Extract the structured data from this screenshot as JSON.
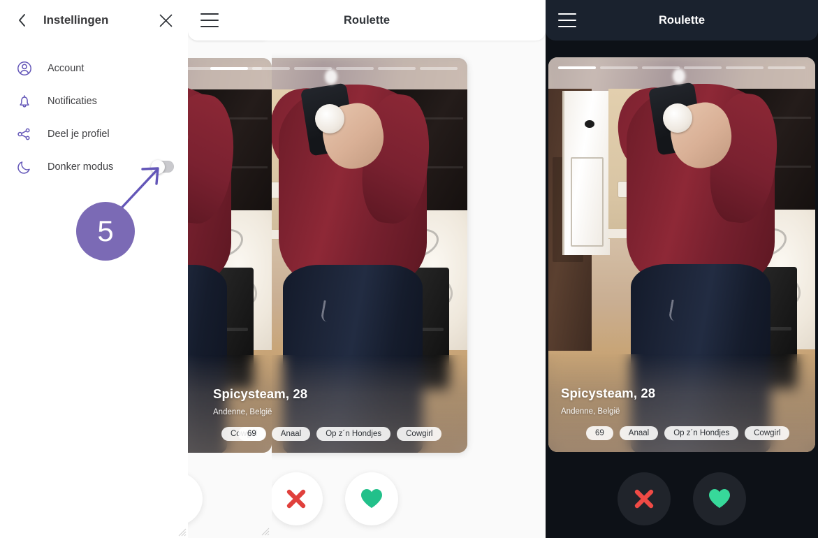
{
  "settings": {
    "title": "Instellingen",
    "back_icon": "chevron-left-icon",
    "close_icon": "close-icon",
    "items": [
      {
        "label": "Account",
        "icon": "user-circle-icon"
      },
      {
        "label": "Notificaties",
        "icon": "bell-icon"
      },
      {
        "label": "Deel je profiel",
        "icon": "share-nodes-icon"
      },
      {
        "label": "Donker modus",
        "icon": "moon-icon",
        "toggle": true,
        "toggle_state": "off"
      }
    ],
    "callout_number": "5",
    "accent_purple": "#6356b8",
    "badge_purple": "#7b6ab5"
  },
  "phone_light": {
    "appbar": {
      "title": "Roulette",
      "menu_icon": "hamburger-icon"
    },
    "card": {
      "name": "Spicysteam, 28",
      "location": "Andenne, België",
      "tags": [
        "69",
        "Anaal",
        "Op z´n Hondjes",
        "Cowgirl"
      ],
      "progress_total": 6,
      "progress_active": 1
    },
    "actions": {
      "reject_icon": "close-x-icon",
      "like_icon": "heart-icon",
      "reject_color": "#e0403c",
      "like_color": "#22c08a"
    }
  },
  "phone_dark": {
    "appbar": {
      "title": "Roulette",
      "menu_icon": "hamburger-icon"
    },
    "card": {
      "name": "Spicysteam, 28",
      "location": "Andenne, België",
      "tags": [
        "69",
        "Anaal",
        "Op z´n Hondjes",
        "Cowgirl"
      ],
      "progress_total": 6,
      "progress_active": 1
    },
    "actions": {
      "reject_icon": "close-x-icon",
      "like_icon": "heart-icon",
      "reject_color": "#ef4a45",
      "like_color": "#37d99a"
    },
    "bg_color": "#0d1117",
    "appbar_color": "#1a222e"
  },
  "phone_peek": {
    "card": {
      "tags": [
        "Cowgirl"
      ]
    }
  }
}
